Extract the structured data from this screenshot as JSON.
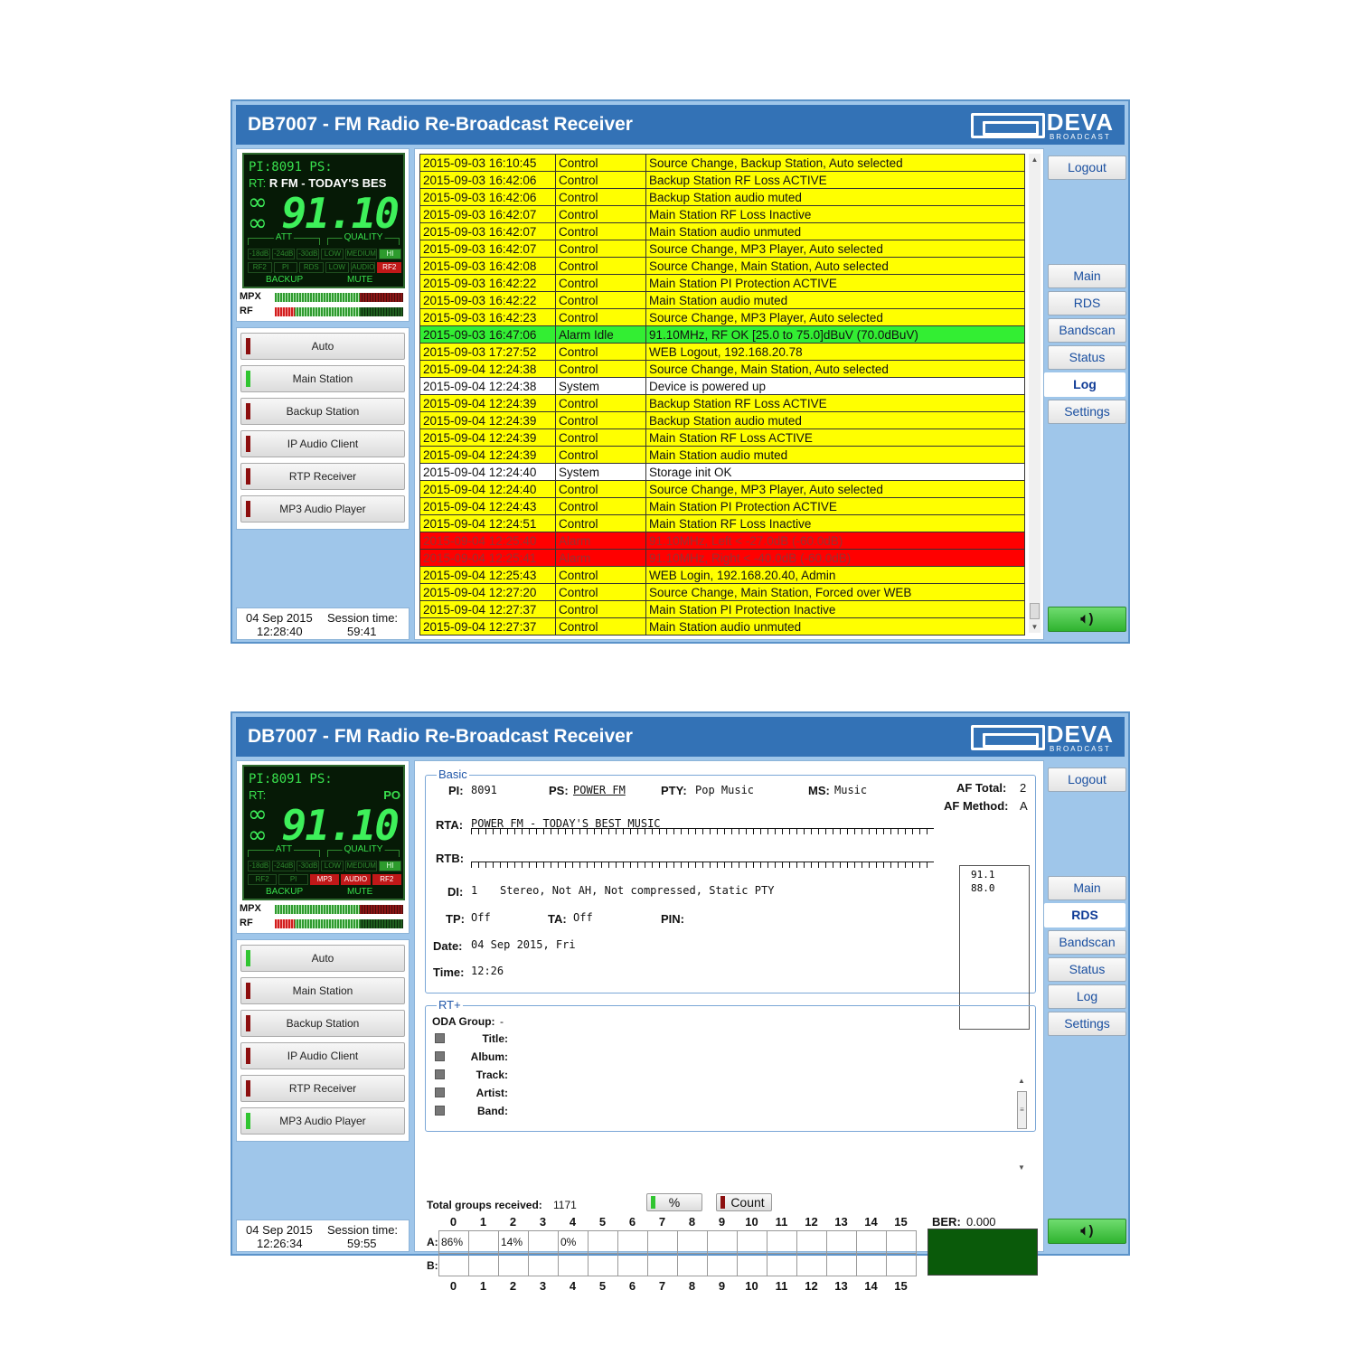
{
  "app": {
    "title": "DB7007 - FM Radio Re-Broadcast Receiver",
    "logo_main": "DEVA",
    "logo_sub": "BROADCAST",
    "colors": {
      "header": "#3372b6",
      "panel": "#9fc6ea",
      "log_control": "#ffff00",
      "log_idle": "#33ee33",
      "log_alarm": "#ff0000"
    }
  },
  "nav": {
    "logout": "Logout",
    "items": [
      "Main",
      "RDS",
      "Bandscan",
      "Status",
      "Log",
      "Settings"
    ],
    "speaker_icon": "speaker-icon"
  },
  "sources": [
    "Auto",
    "Main Station",
    "Backup Station",
    "IP Audio Client",
    "RTP Receiver",
    "MP3 Audio Player"
  ],
  "meters": {
    "mpx": "MPX",
    "rf": "RF"
  },
  "panel1": {
    "active_tab": "Log",
    "lcd": {
      "pi_ps": "PI:8091 PS:",
      "rt_label": "RT:",
      "rt_value": "R FM - TODAY'S BES",
      "freq": "91.10",
      "att": "ATT",
      "quality": "QUALITY",
      "backup": "BACKUP",
      "mute": "MUTE",
      "row1": [
        "-18dB",
        "-24dB",
        "-30dB",
        "LOW",
        "MEDIUM",
        "HI"
      ],
      "row2": [
        "RF2",
        "PI",
        "RDS",
        "LOW",
        "AUDIO",
        "RF2"
      ]
    },
    "active_source": "Main Station",
    "date": "04 Sep 2015",
    "time": "12:28:40",
    "session_label": "Session time:",
    "session": "59:41",
    "log": [
      [
        "2015-09-03 16:10:45",
        "Control",
        "Source Change, Backup Station, Auto selected",
        "y"
      ],
      [
        "2015-09-03 16:42:06",
        "Control",
        "Backup Station RF Loss ACTIVE",
        "y"
      ],
      [
        "2015-09-03 16:42:06",
        "Control",
        "Backup Station audio muted",
        "y"
      ],
      [
        "2015-09-03 16:42:07",
        "Control",
        "Main Station RF Loss Inactive",
        "y"
      ],
      [
        "2015-09-03 16:42:07",
        "Control",
        "Main Station audio unmuted",
        "y"
      ],
      [
        "2015-09-03 16:42:07",
        "Control",
        "Source Change, MP3 Player, Auto selected",
        "y"
      ],
      [
        "2015-09-03 16:42:08",
        "Control",
        "Source Change, Main Station, Auto selected",
        "y"
      ],
      [
        "2015-09-03 16:42:22",
        "Control",
        "Main Station PI Protection ACTIVE",
        "y"
      ],
      [
        "2015-09-03 16:42:22",
        "Control",
        "Main Station audio muted",
        "y"
      ],
      [
        "2015-09-03 16:42:23",
        "Control",
        "Source Change, MP3 Player, Auto selected",
        "y"
      ],
      [
        "2015-09-03 16:47:06",
        "Alarm Idle",
        "91.10MHz, RF OK [25.0 to 75.0]dBuV (70.0dBuV)",
        "g"
      ],
      [
        "2015-09-03 17:27:52",
        "Control",
        "WEB Logout, 192.168.20.78",
        "y"
      ],
      [
        "2015-09-04 12:24:38",
        "Control",
        "Source Change, Main Station, Auto selected",
        "y"
      ],
      [
        "2015-09-04 12:24:38",
        "System",
        "Device is powered up",
        "w"
      ],
      [
        "2015-09-04 12:24:39",
        "Control",
        "Backup Station RF Loss ACTIVE",
        "y"
      ],
      [
        "2015-09-04 12:24:39",
        "Control",
        "Backup Station audio muted",
        "y"
      ],
      [
        "2015-09-04 12:24:39",
        "Control",
        "Main Station RF Loss ACTIVE",
        "y"
      ],
      [
        "2015-09-04 12:24:39",
        "Control",
        "Main Station audio muted",
        "y"
      ],
      [
        "2015-09-04 12:24:40",
        "System",
        "Storage init OK",
        "w"
      ],
      [
        "2015-09-04 12:24:40",
        "Control",
        "Source Change, MP3 Player, Auto selected",
        "y"
      ],
      [
        "2015-09-04 12:24:43",
        "Control",
        "Main Station PI Protection ACTIVE",
        "y"
      ],
      [
        "2015-09-04 12:24:51",
        "Control",
        "Main Station RF Loss Inactive",
        "y"
      ],
      [
        "2015-09-04 12:25:40",
        "Alarm",
        "91.10MHz, Left < -27.0dB (-60.0dB)",
        "r"
      ],
      [
        "2015-09-04 12:25:41",
        "Alarm",
        "91.10MHz, Right < -40.0dB (-60.0dB)",
        "r"
      ],
      [
        "2015-09-04 12:25:43",
        "Control",
        "WEB Login, 192.168.20.40, Admin",
        "y"
      ],
      [
        "2015-09-04 12:27:20",
        "Control",
        "Source Change, Main Station, Forced over WEB",
        "y"
      ],
      [
        "2015-09-04 12:27:37",
        "Control",
        "Main Station PI Protection Inactive",
        "y"
      ],
      [
        "2015-09-04 12:27:37",
        "Control",
        "Main Station audio unmuted",
        "y"
      ]
    ]
  },
  "panel2": {
    "active_tab": "RDS",
    "lcd": {
      "pi_ps": "PI:8091 PS:",
      "rt_label": "RT:",
      "rt_value": "PO",
      "freq": "91.10",
      "att": "ATT",
      "quality": "QUALITY",
      "backup": "BACKUP",
      "mute": "MUTE",
      "row1": [
        "-18dB",
        "-24dB",
        "-30dB",
        "LOW",
        "MEDIUM",
        "HI"
      ],
      "row2": [
        "RF2",
        "PI",
        "MP3",
        "AUDIO",
        "RF2"
      ]
    },
    "active_source": "Auto",
    "date": "04 Sep 2015",
    "time": "12:26:34",
    "session_label": "Session time:",
    "session": "59:55",
    "basic": {
      "legend": "Basic",
      "pi_label": "PI:",
      "pi": "8091",
      "ps_label": "PS:",
      "ps": "POWER FM",
      "pty_label": "PTY:",
      "pty": "Pop Music",
      "ms_label": "MS:",
      "ms": "Music",
      "af_total_label": "AF Total:",
      "af_total": "2",
      "af_method_label": "AF Method:",
      "af_method": "A",
      "af_list": [
        "91.1",
        "88.0"
      ],
      "rta_label": "RTA:",
      "rta": "POWER FM - TODAY'S BEST MUSIC",
      "rtb_label": "RTB:",
      "di_label": "DI:",
      "di": "1",
      "di_text": "Stereo, Not AH, Not compressed, Static PTY",
      "tp_label": "TP:",
      "tp": "Off",
      "ta_label": "TA:",
      "ta": "Off",
      "pin_label": "PIN:",
      "date_label": "Date:",
      "date": "04 Sep 2015, Fri",
      "time_label": "Time:",
      "time": "12:26"
    },
    "rtplus": {
      "legend": "RT+",
      "oda_label": "ODA Group:",
      "oda": "-",
      "fields": [
        "Title:",
        "Album:",
        "Track:",
        "Artist:",
        "Band:"
      ]
    },
    "groups": {
      "total_label": "Total groups received:",
      "total": "1171",
      "pct_btn": "%",
      "count_btn": "Count",
      "numbers": [
        "0",
        "1",
        "2",
        "3",
        "4",
        "5",
        "6",
        "7",
        "8",
        "9",
        "10",
        "11",
        "12",
        "13",
        "14",
        "15"
      ],
      "row_a_label": "A:",
      "row_b_label": "B:",
      "row_a": [
        "86%",
        "",
        "14%",
        "",
        "0%",
        "",
        "",
        "",
        "",
        "",
        "",
        "",
        "",
        "",
        "",
        ""
      ],
      "row_b": [
        "",
        "",
        "",
        "",
        "",
        "",
        "",
        "",
        "",
        "",
        "",
        "",
        "",
        "",
        "",
        ""
      ],
      "ber_label": "BER:",
      "ber": "0.000"
    }
  }
}
